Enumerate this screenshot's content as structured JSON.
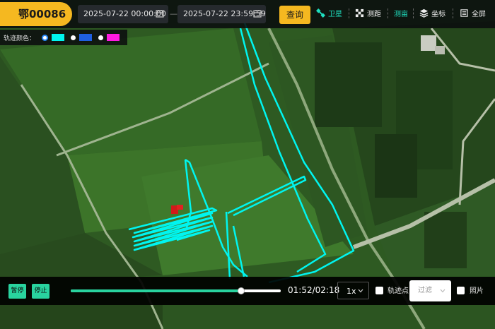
{
  "header": {
    "vehicle_plate": "鄂00086",
    "start_datetime": "2025-07-22 00:00:00",
    "range_separator": "—",
    "end_datetime": "2025-07-22 23:59:59",
    "query_label": "查询"
  },
  "toolbar": {
    "satellite_label": "卫星",
    "measure_distance_label": "测距",
    "measure_area_label": "测亩",
    "coordinate_label": "坐标",
    "fullscreen_label": "全屏"
  },
  "track_color": {
    "label": "轨迹颜色：",
    "options": [
      {
        "color": "#00f5f0",
        "selected": true
      },
      {
        "color": "#1f5fe0",
        "selected": false
      },
      {
        "color": "#ff19e0",
        "selected": false
      }
    ]
  },
  "playback": {
    "pause_label": "暂停",
    "stop_label": "停止",
    "elapsed": "01:52",
    "total": "02:18",
    "time_text": "01:52/02:18",
    "progress": 0.81,
    "speed_value": "1x",
    "track_points_label": "轨迹点",
    "filter_placeholder": "过滤",
    "photos_label": "照片"
  },
  "colors": {
    "accent_yellow": "#f5b820",
    "accent_green": "#29d39f",
    "track_cyan": "#00f5f0",
    "vehicle_red": "#d11a1a"
  }
}
